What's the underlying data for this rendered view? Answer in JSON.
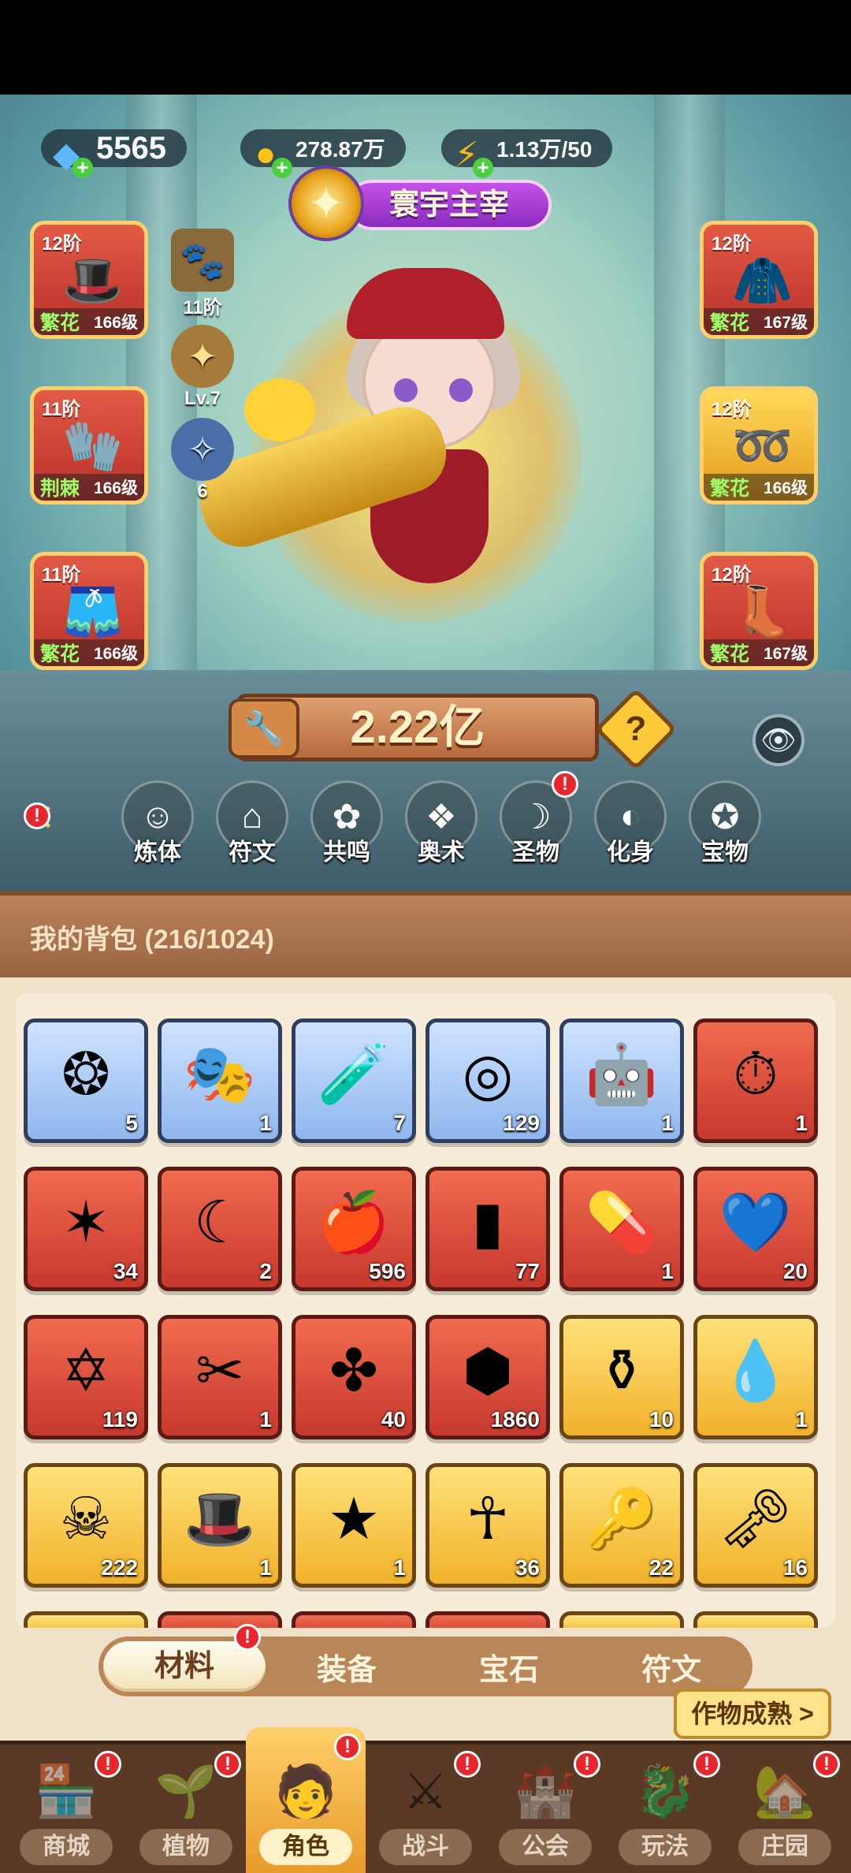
{
  "currency": {
    "gems": "5565",
    "gold": "278.87万",
    "energy": "1.13万/50"
  },
  "character": {
    "title": "寰宇主宰",
    "power": "2.22亿",
    "stats": [
      {
        "label": "11阶",
        "icon": "tier-badge-icon"
      },
      {
        "label": "Lv.7",
        "icon": "star-level-icon"
      },
      {
        "label": "6",
        "icon": "spirit-orb-icon"
      }
    ]
  },
  "equipment": {
    "left": [
      {
        "tier": "12阶",
        "quality": "繁花",
        "level": "166级",
        "icon": "hat-icon"
      },
      {
        "tier": "11阶",
        "quality": "荆棘",
        "level": "166级",
        "icon": "glove-icon"
      },
      {
        "tier": "11阶",
        "quality": "繁花",
        "level": "166级",
        "icon": "shorts-icon"
      }
    ],
    "right": [
      {
        "tier": "12阶",
        "quality": "繁花",
        "level": "167级",
        "icon": "jacket-icon"
      },
      {
        "tier": "12阶",
        "quality": "繁花",
        "level": "166级",
        "icon": "belt-icon"
      },
      {
        "tier": "12阶",
        "quality": "繁花",
        "level": "167级",
        "icon": "boots-icon"
      }
    ]
  },
  "functions": [
    {
      "label": "炼体",
      "icon": "body-refine-icon",
      "alert": false
    },
    {
      "label": "符文",
      "icon": "rune-icon",
      "alert": false
    },
    {
      "label": "共鸣",
      "icon": "resonance-icon",
      "alert": false
    },
    {
      "label": "奥术",
      "icon": "arcane-book-icon",
      "alert": false
    },
    {
      "label": "圣物",
      "icon": "relic-icon",
      "alert": true
    },
    {
      "label": "化身",
      "icon": "avatar-icon",
      "alert": false
    },
    {
      "label": "宝物",
      "icon": "treasure-icon",
      "alert": false
    }
  ],
  "bag": {
    "title": "我的背包 (216/1024)",
    "items": [
      {
        "rarity": "blue",
        "icon": "scarab-gem-icon",
        "count": "5"
      },
      {
        "rarity": "blue",
        "icon": "mask-icon",
        "count": "1"
      },
      {
        "rarity": "blue",
        "icon": "potion-canister-icon",
        "count": "7"
      },
      {
        "rarity": "blue",
        "icon": "portal-ring-icon",
        "count": "129"
      },
      {
        "rarity": "blue",
        "icon": "robot-avatar-icon",
        "count": "1"
      },
      {
        "rarity": "red",
        "icon": "clock-card-icon",
        "count": "1"
      },
      {
        "rarity": "red",
        "icon": "crystal-star-icon",
        "count": "34"
      },
      {
        "rarity": "red",
        "icon": "moon-star-icon",
        "count": "2"
      },
      {
        "rarity": "red",
        "icon": "apple-potion-icon",
        "count": "596"
      },
      {
        "rarity": "red",
        "icon": "green-vial-icon",
        "count": "77"
      },
      {
        "rarity": "red",
        "icon": "green-pill-icon",
        "count": "1"
      },
      {
        "rarity": "red",
        "icon": "heart-necklace-icon",
        "count": "20"
      },
      {
        "rarity": "red",
        "icon": "hexagram-icon",
        "count": "119"
      },
      {
        "rarity": "red",
        "icon": "scissors-icon",
        "count": "1"
      },
      {
        "rarity": "red",
        "icon": "knot-icon",
        "count": "40"
      },
      {
        "rarity": "red",
        "icon": "crystal-cluster-icon",
        "count": "1860"
      },
      {
        "rarity": "gold",
        "icon": "perfume-bottle-icon",
        "count": "10"
      },
      {
        "rarity": "gold",
        "icon": "water-drop-icon",
        "count": "1"
      },
      {
        "rarity": "gold",
        "icon": "skull-card-icon",
        "count": "222"
      },
      {
        "rarity": "gold",
        "icon": "magic-hat-icon",
        "count": "1"
      },
      {
        "rarity": "gold",
        "icon": "star-token-icon",
        "count": "1"
      },
      {
        "rarity": "gold",
        "icon": "ankh-icon",
        "count": "36"
      },
      {
        "rarity": "gold",
        "icon": "ruby-key-icon",
        "count": "22"
      },
      {
        "rarity": "gold",
        "icon": "gold-key-icon",
        "count": "16"
      }
    ],
    "partial_row": [
      "gold",
      "red",
      "red",
      "red",
      "gold",
      "gold"
    ]
  },
  "tabs": [
    {
      "label": "材料",
      "active": true,
      "alert": true
    },
    {
      "label": "装备",
      "active": false,
      "alert": false
    },
    {
      "label": "宝石",
      "active": false,
      "alert": false
    },
    {
      "label": "符文",
      "active": false,
      "alert": false
    }
  ],
  "crop_button": "作物成熟 >",
  "nav": [
    {
      "label": "商城",
      "icon": "shop-icon",
      "active": false
    },
    {
      "label": "植物",
      "icon": "plant-icon",
      "active": false
    },
    {
      "label": "角色",
      "icon": "character-icon",
      "active": true
    },
    {
      "label": "战斗",
      "icon": "battle-icon",
      "active": false
    },
    {
      "label": "公会",
      "icon": "guild-icon",
      "active": false
    },
    {
      "label": "玩法",
      "icon": "gameplay-icon",
      "active": false
    },
    {
      "label": "庄园",
      "icon": "manor-icon",
      "active": false
    }
  ]
}
